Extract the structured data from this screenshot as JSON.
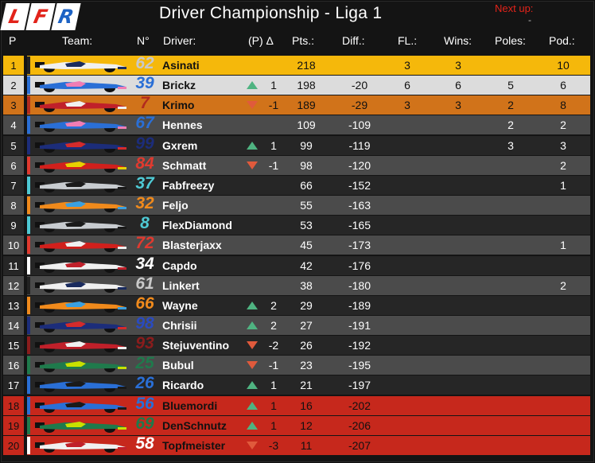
{
  "logo_letters": [
    "L",
    "F",
    "R"
  ],
  "title": "Driver Championship - Liga 1",
  "next_up_label": "Next up:",
  "next_up_value": "-",
  "headers": {
    "pos": "P",
    "team": "Team:",
    "num": "N°",
    "driver": "Driver:",
    "change": "(P) Δ",
    "pts": "Pts.:",
    "diff": "Diff.:",
    "fl": "FL.:",
    "wins": "Wins:",
    "poles": "Poles:",
    "pod": "Pod.:"
  },
  "rows": [
    {
      "pos": "1",
      "num": "62",
      "driver": "Asinati",
      "trend": "",
      "delta": "",
      "pts": "218",
      "diff": "",
      "fl": "3",
      "wins": "3",
      "poles": "",
      "pod": "10",
      "bg": "#f5b80b",
      "posbg": "#f5b80b",
      "fg": "#111",
      "numcolor": "#c9c9c9",
      "strip": "#222",
      "car": "#f0f0f0",
      "car2": "#1a2b5e"
    },
    {
      "pos": "2",
      "num": "39",
      "driver": "Brickz",
      "trend": "up",
      "delta": "1",
      "pts": "198",
      "diff": "-20",
      "fl": "6",
      "wins": "6",
      "poles": "5",
      "pod": "6",
      "bg": "#dcdcdc",
      "posbg": "#dcdcdc",
      "fg": "#111",
      "numcolor": "#2a6fd6",
      "strip": "#2a6fd6",
      "car": "#2a6fd6",
      "car2": "#f07db4"
    },
    {
      "pos": "3",
      "num": "7",
      "driver": "Krimo",
      "trend": "down",
      "delta": "-1",
      "pts": "189",
      "diff": "-29",
      "fl": "3",
      "wins": "3",
      "poles": "2",
      "pod": "8",
      "bg": "#d1731a",
      "posbg": "#d1731a",
      "fg": "#111",
      "numcolor": "#b22b1e",
      "strip": "#b22b1e",
      "car": "#c0202a",
      "car2": "#f0f0f0"
    },
    {
      "pos": "4",
      "num": "67",
      "driver": "Hennes",
      "trend": "",
      "delta": "",
      "pts": "109",
      "diff": "-109",
      "fl": "",
      "wins": "",
      "poles": "2",
      "pod": "2",
      "bg": "#4b4b4b",
      "posbg": "#4b4b4b",
      "fg": "#fff",
      "numcolor": "#2a6fd6",
      "strip": "#2a6fd6",
      "car": "#2a6fd6",
      "car2": "#f07db4"
    },
    {
      "pos": "5",
      "num": "99",
      "driver": "Gxrem",
      "trend": "up",
      "delta": "1",
      "pts": "99",
      "diff": "-119",
      "fl": "",
      "wins": "",
      "poles": "3",
      "pod": "3",
      "bg": "#262626",
      "posbg": "#262626",
      "fg": "#fff",
      "numcolor": "#1c2d7a",
      "strip": "#1c2d7a",
      "car": "#1c2d7a",
      "car2": "#d42b2b"
    },
    {
      "pos": "6",
      "num": "84",
      "driver": "Schmatt",
      "trend": "down",
      "delta": "-1",
      "pts": "98",
      "diff": "-120",
      "fl": "",
      "wins": "",
      "poles": "",
      "pod": "2",
      "bg": "#4b4b4b",
      "posbg": "#4b4b4b",
      "fg": "#fff",
      "numcolor": "#e03a2f",
      "strip": "#e03a2f",
      "car": "#d1201c",
      "car2": "#e8d000"
    },
    {
      "pos": "7",
      "num": "37",
      "driver": "Fabfreezy",
      "trend": "",
      "delta": "",
      "pts": "66",
      "diff": "-152",
      "fl": "",
      "wins": "",
      "poles": "",
      "pod": "1",
      "bg": "#262626",
      "posbg": "#262626",
      "fg": "#fff",
      "numcolor": "#4ec9d4",
      "strip": "#4ec9d4",
      "car": "#c8ccd0",
      "car2": "#1a1a1a"
    },
    {
      "pos": "8",
      "num": "32",
      "driver": "Feljo",
      "trend": "",
      "delta": "",
      "pts": "55",
      "diff": "-163",
      "fl": "",
      "wins": "",
      "poles": "",
      "pod": "",
      "bg": "#4b4b4b",
      "posbg": "#4b4b4b",
      "fg": "#fff",
      "numcolor": "#f08a1c",
      "strip": "#f08a1c",
      "car": "#f08a1c",
      "car2": "#3aa0e0"
    },
    {
      "pos": "9",
      "num": "8",
      "driver": "FlexDiamond",
      "trend": "",
      "delta": "",
      "pts": "53",
      "diff": "-165",
      "fl": "",
      "wins": "",
      "poles": "",
      "pod": "",
      "bg": "#262626",
      "posbg": "#262626",
      "fg": "#fff",
      "numcolor": "#4ec9d4",
      "strip": "#4ec9d4",
      "car": "#c8ccd0",
      "car2": "#1a1a1a"
    },
    {
      "pos": "10",
      "num": "72",
      "driver": "Blasterjaxx",
      "trend": "",
      "delta": "",
      "pts": "45",
      "diff": "-173",
      "fl": "",
      "wins": "",
      "poles": "",
      "pod": "1",
      "bg": "#4b4b4b",
      "posbg": "#4b4b4b",
      "fg": "#fff",
      "numcolor": "#e03a2f",
      "strip": "#e03a2f",
      "car": "#d1201c",
      "car2": "#f0f0f0"
    },
    {
      "pos": "11",
      "num": "34",
      "driver": "Capdo",
      "trend": "",
      "delta": "",
      "pts": "42",
      "diff": "-176",
      "fl": "",
      "wins": "",
      "poles": "",
      "pod": "",
      "bg": "#262626",
      "posbg": "#262626",
      "fg": "#fff",
      "numcolor": "#ffffff",
      "strip": "#ffffff",
      "car": "#f0f0f0",
      "car2": "#c0202a"
    },
    {
      "pos": "12",
      "num": "61",
      "driver": "Linkert",
      "trend": "",
      "delta": "",
      "pts": "38",
      "diff": "-180",
      "fl": "",
      "wins": "",
      "poles": "",
      "pod": "2",
      "bg": "#4b4b4b",
      "posbg": "#4b4b4b",
      "fg": "#fff",
      "numcolor": "#c9c9c9",
      "strip": "#222",
      "car": "#f0f0f0",
      "car2": "#1a2b5e"
    },
    {
      "pos": "13",
      "num": "66",
      "driver": "Wayne",
      "trend": "up",
      "delta": "2",
      "pts": "29",
      "diff": "-189",
      "fl": "",
      "wins": "",
      "poles": "",
      "pod": "",
      "bg": "#262626",
      "posbg": "#262626",
      "fg": "#fff",
      "numcolor": "#f08a1c",
      "strip": "#f08a1c",
      "car": "#f08a1c",
      "car2": "#3aa0e0"
    },
    {
      "pos": "14",
      "num": "98",
      "driver": "Chrisii",
      "trend": "up",
      "delta": "2",
      "pts": "27",
      "diff": "-191",
      "fl": "",
      "wins": "",
      "poles": "",
      "pod": "",
      "bg": "#4b4b4b",
      "posbg": "#4b4b4b",
      "fg": "#fff",
      "numcolor": "#2a4bbf",
      "strip": "#1c2d7a",
      "car": "#1c2d7a",
      "car2": "#d42b2b"
    },
    {
      "pos": "15",
      "num": "93",
      "driver": "Stejuventino",
      "trend": "down",
      "delta": "-2",
      "pts": "26",
      "diff": "-192",
      "fl": "",
      "wins": "",
      "poles": "",
      "pod": "",
      "bg": "#262626",
      "posbg": "#262626",
      "fg": "#fff",
      "numcolor": "#8a1c1c",
      "strip": "#8a1c1c",
      "car": "#c0202a",
      "car2": "#f0f0f0"
    },
    {
      "pos": "16",
      "num": "25",
      "driver": "Bubul",
      "trend": "down",
      "delta": "-1",
      "pts": "23",
      "diff": "-195",
      "fl": "",
      "wins": "",
      "poles": "",
      "pod": "",
      "bg": "#4b4b4b",
      "posbg": "#4b4b4b",
      "fg": "#fff",
      "numcolor": "#1f7a4c",
      "strip": "#1f7a4c",
      "car": "#1f7a4c",
      "car2": "#c8e000"
    },
    {
      "pos": "17",
      "num": "26",
      "driver": "Ricardo",
      "trend": "up",
      "delta": "1",
      "pts": "21",
      "diff": "-197",
      "fl": "",
      "wins": "",
      "poles": "",
      "pod": "",
      "bg": "#262626",
      "posbg": "#262626",
      "fg": "#fff",
      "numcolor": "#2a6fd6",
      "strip": "#2a6fd6",
      "car": "#2a6fd6",
      "car2": "#1a1a1a"
    },
    {
      "pos": "18",
      "num": "56",
      "driver": "Bluemordi",
      "trend": "up",
      "delta": "1",
      "pts": "16",
      "diff": "-202",
      "fl": "",
      "wins": "",
      "poles": "",
      "pod": "",
      "bg": "#c6281c",
      "posbg": "#c6281c",
      "fg": "#111",
      "numcolor": "#2a6fd6",
      "strip": "#2a6fd6",
      "car": "#2a6fd6",
      "car2": "#1a1a1a"
    },
    {
      "pos": "19",
      "num": "69",
      "driver": "DenSchnutz",
      "trend": "up",
      "delta": "1",
      "pts": "12",
      "diff": "-206",
      "fl": "",
      "wins": "",
      "poles": "",
      "pod": "",
      "bg": "#c6281c",
      "posbg": "#c6281c",
      "fg": "#111",
      "numcolor": "#1f7a4c",
      "strip": "#1f7a4c",
      "car": "#1f7a4c",
      "car2": "#c8e000"
    },
    {
      "pos": "20",
      "num": "58",
      "driver": "Topfmeister",
      "trend": "down",
      "delta": "-3",
      "pts": "11",
      "diff": "-207",
      "fl": "",
      "wins": "",
      "poles": "",
      "pod": "",
      "bg": "#c6281c",
      "posbg": "#c6281c",
      "fg": "#111",
      "numcolor": "#ffffff",
      "strip": "#ffffff",
      "car": "#f0f0f0",
      "car2": "#c0202a"
    }
  ]
}
